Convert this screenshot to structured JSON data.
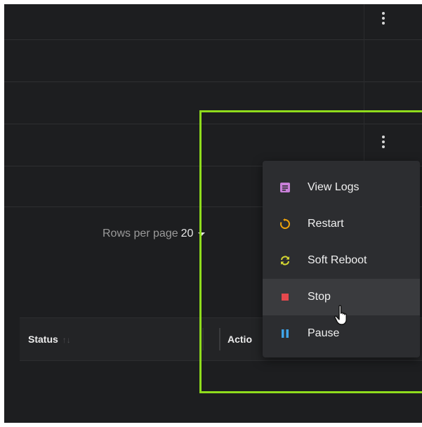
{
  "table": {
    "row_menu_icon": "more-vert-icon",
    "pagination": {
      "label": "Rows per page",
      "value": "20"
    },
    "headers": {
      "status": "Status",
      "sort_icon": "↑↓",
      "actions": "Actio"
    }
  },
  "context_menu": {
    "items": [
      {
        "label": "View Logs",
        "icon": "view-logs-icon",
        "color": "#c87fd8"
      },
      {
        "label": "Restart",
        "icon": "restart-icon",
        "color": "#f0a30a"
      },
      {
        "label": "Soft Reboot",
        "icon": "soft-reboot-icon",
        "color": "#d6d832"
      },
      {
        "label": "Stop",
        "icon": "stop-icon",
        "color": "#e5484d",
        "hovered": true
      },
      {
        "label": "Pause",
        "icon": "pause-icon",
        "color": "#3fa4e8"
      }
    ]
  },
  "highlight": {
    "color": "#8fdc1c"
  }
}
